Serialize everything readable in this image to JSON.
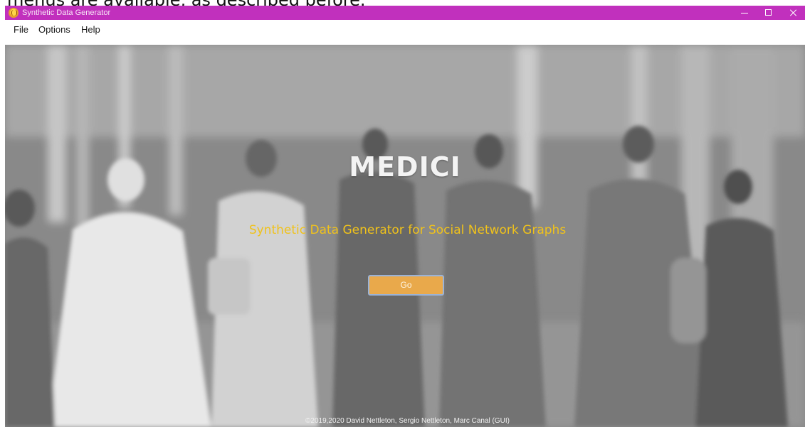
{
  "caption": {
    "text": "menus are available, as described before."
  },
  "window": {
    "title": "Synthetic Data Generator",
    "titlebar_color": "#c130bd",
    "icon": "app-icon",
    "controls": {
      "minimize": "minimize-icon",
      "maximize": "maximize-icon",
      "close": "close-icon"
    }
  },
  "menubar": {
    "items": [
      {
        "label": "File"
      },
      {
        "label": "Options"
      },
      {
        "label": "Help"
      }
    ]
  },
  "main": {
    "title": "MEDICI",
    "subtitle": "Synthetic Data Generator for Social Network Graphs",
    "subtitle_color": "#f0c21b",
    "go_button": {
      "label": "Go",
      "color": "#e9a94b"
    },
    "footer": "©2019,2020 David Nettleton, Sergio Nettleton, Marc Canal (GUI)"
  }
}
